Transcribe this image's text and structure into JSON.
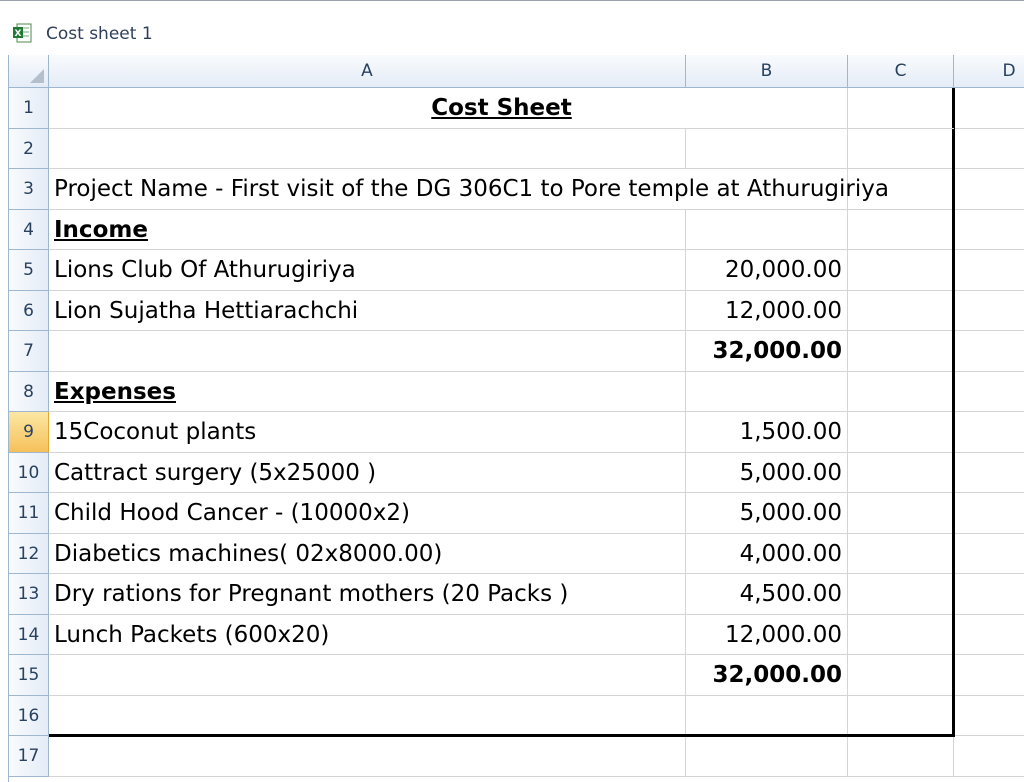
{
  "window": {
    "title": "Cost sheet 1"
  },
  "columns": [
    "A",
    "B",
    "C",
    "D"
  ],
  "rows": [
    {
      "num": "1",
      "a": "Cost Sheet",
      "b": "",
      "a_style": "title"
    },
    {
      "num": "2",
      "a": "",
      "b": ""
    },
    {
      "num": "3",
      "a": "Project Name - First visit of the DG 306C1 to Pore temple at Athurugiriya",
      "b": ""
    },
    {
      "num": "4",
      "a": "Income",
      "b": "",
      "a_style": "heading"
    },
    {
      "num": "5",
      "a": "Lions Club Of Athurugiriya",
      "b": "20,000.00"
    },
    {
      "num": "6",
      "a": "Lion Sujatha Hettiarachchi",
      "b": "12,000.00"
    },
    {
      "num": "7",
      "a": "",
      "b": "32,000.00",
      "b_style": "total"
    },
    {
      "num": "8",
      "a": "Expenses",
      "b": "",
      "a_style": "heading"
    },
    {
      "num": "9",
      "a": "15Coconut  plants",
      "b": "1,500.00"
    },
    {
      "num": "10",
      "a": " Cattract surgery (5x25000 )",
      "b": "5,000.00"
    },
    {
      "num": "11",
      "a": "Child Hood Cancer - (10000x2)",
      "b": "5,000.00"
    },
    {
      "num": "12",
      "a": "Diabetics machines( 02x8000.00)",
      "b": "4,000.00"
    },
    {
      "num": "13",
      "a": "Dry rations for Pregnant mothers (20 Packs )",
      "b": "4,500.00"
    },
    {
      "num": "14",
      "a": "Lunch Packets (600x20)",
      "b": "12,000.00"
    },
    {
      "num": "15",
      "a": "",
      "b": "32,000.00",
      "b_style": "total"
    },
    {
      "num": "16",
      "a": "",
      "b": ""
    },
    {
      "num": "17",
      "a": "",
      "b": ""
    }
  ],
  "selection": {
    "active_row": "9"
  },
  "colors": {
    "header_bg": "#e4ecf7",
    "active_row_header": "#f6c15a",
    "grid_line": "#d4d4d4",
    "header_line": "#9eb6ce"
  }
}
